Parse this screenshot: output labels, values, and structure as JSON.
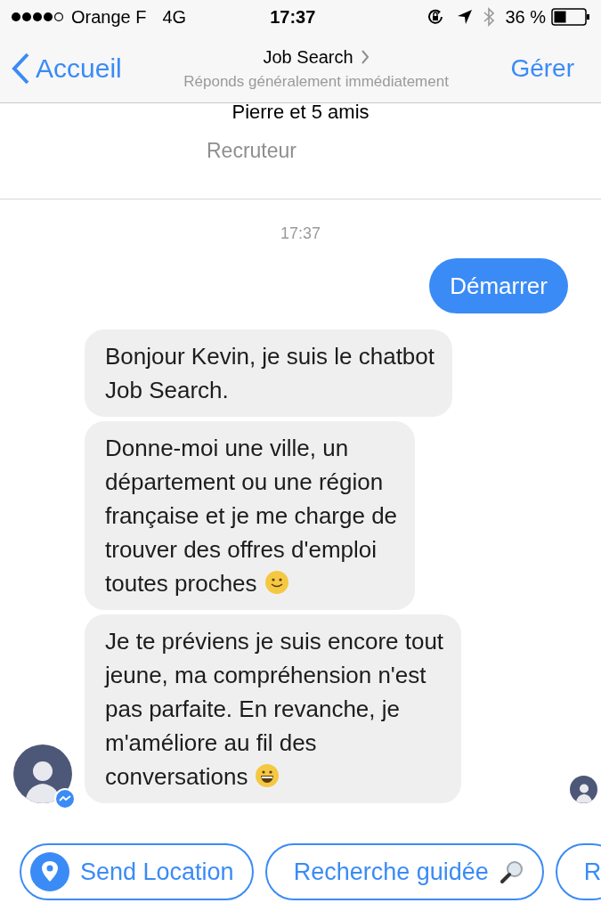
{
  "status_bar": {
    "carrier": "Orange F",
    "network": "4G",
    "time": "17:37",
    "battery": "36 %"
  },
  "nav": {
    "back": "Accueil",
    "title": "Job Search",
    "subtitle": "Réponds généralement immédiatement",
    "action": "Gérer"
  },
  "header": {
    "members": "Pierre et 5 amis",
    "category": "Recruteur"
  },
  "timestamp": "17:37",
  "messages": [
    {
      "kind": "sent",
      "lines": [
        "Démarrer"
      ]
    },
    {
      "kind": "received",
      "lines": [
        "Bonjour Kevin, je suis le chatbot",
        "Job Search."
      ]
    },
    {
      "kind": "received",
      "lines": [
        "Donne-moi une ville, un",
        "département ou une région",
        "française et je me charge de",
        "trouver des offres d'emploi",
        "toutes proches"
      ],
      "emoji": {
        "kind": "smile"
      }
    },
    {
      "kind": "received",
      "lines": [
        "Je te préviens je suis encore tout",
        "jeune, ma compréhension n'est",
        "pas parfaite. En revanche, je",
        "m'améliore au fil des",
        "conversations"
      ],
      "emoji": {
        "kind": "grin"
      }
    }
  ],
  "quick_replies": [
    {
      "kind": "location",
      "label": "Send Location"
    },
    {
      "kind": "search",
      "label": "Recherche guidée"
    },
    {
      "kind": "plain",
      "label": "R"
    }
  ]
}
